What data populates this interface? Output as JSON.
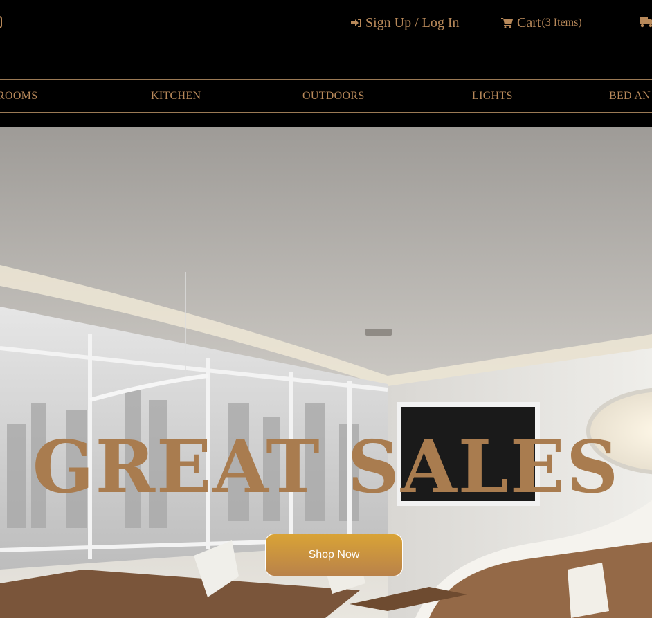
{
  "header": {
    "signup_label": "Sign Up / Log In",
    "cart_label": "Cart",
    "cart_count": "(3 Items)",
    "icons": [
      "phone-icon",
      "sign-in-icon",
      "shopping-cart-icon",
      "truck-icon"
    ]
  },
  "nav": {
    "items": [
      {
        "label": "ROOMS"
      },
      {
        "label": "KITCHEN"
      },
      {
        "label": "OUTDOORS"
      },
      {
        "label": "LIGHTS"
      },
      {
        "label": "BED AN"
      }
    ]
  },
  "hero": {
    "title": "GREAT SALES",
    "button_label": "Shop Now"
  },
  "colors": {
    "background": "#000000",
    "accent": "#b8895a",
    "title": "#a97c4f",
    "button_top": "#d9a336",
    "button_bottom": "#b9824a"
  }
}
